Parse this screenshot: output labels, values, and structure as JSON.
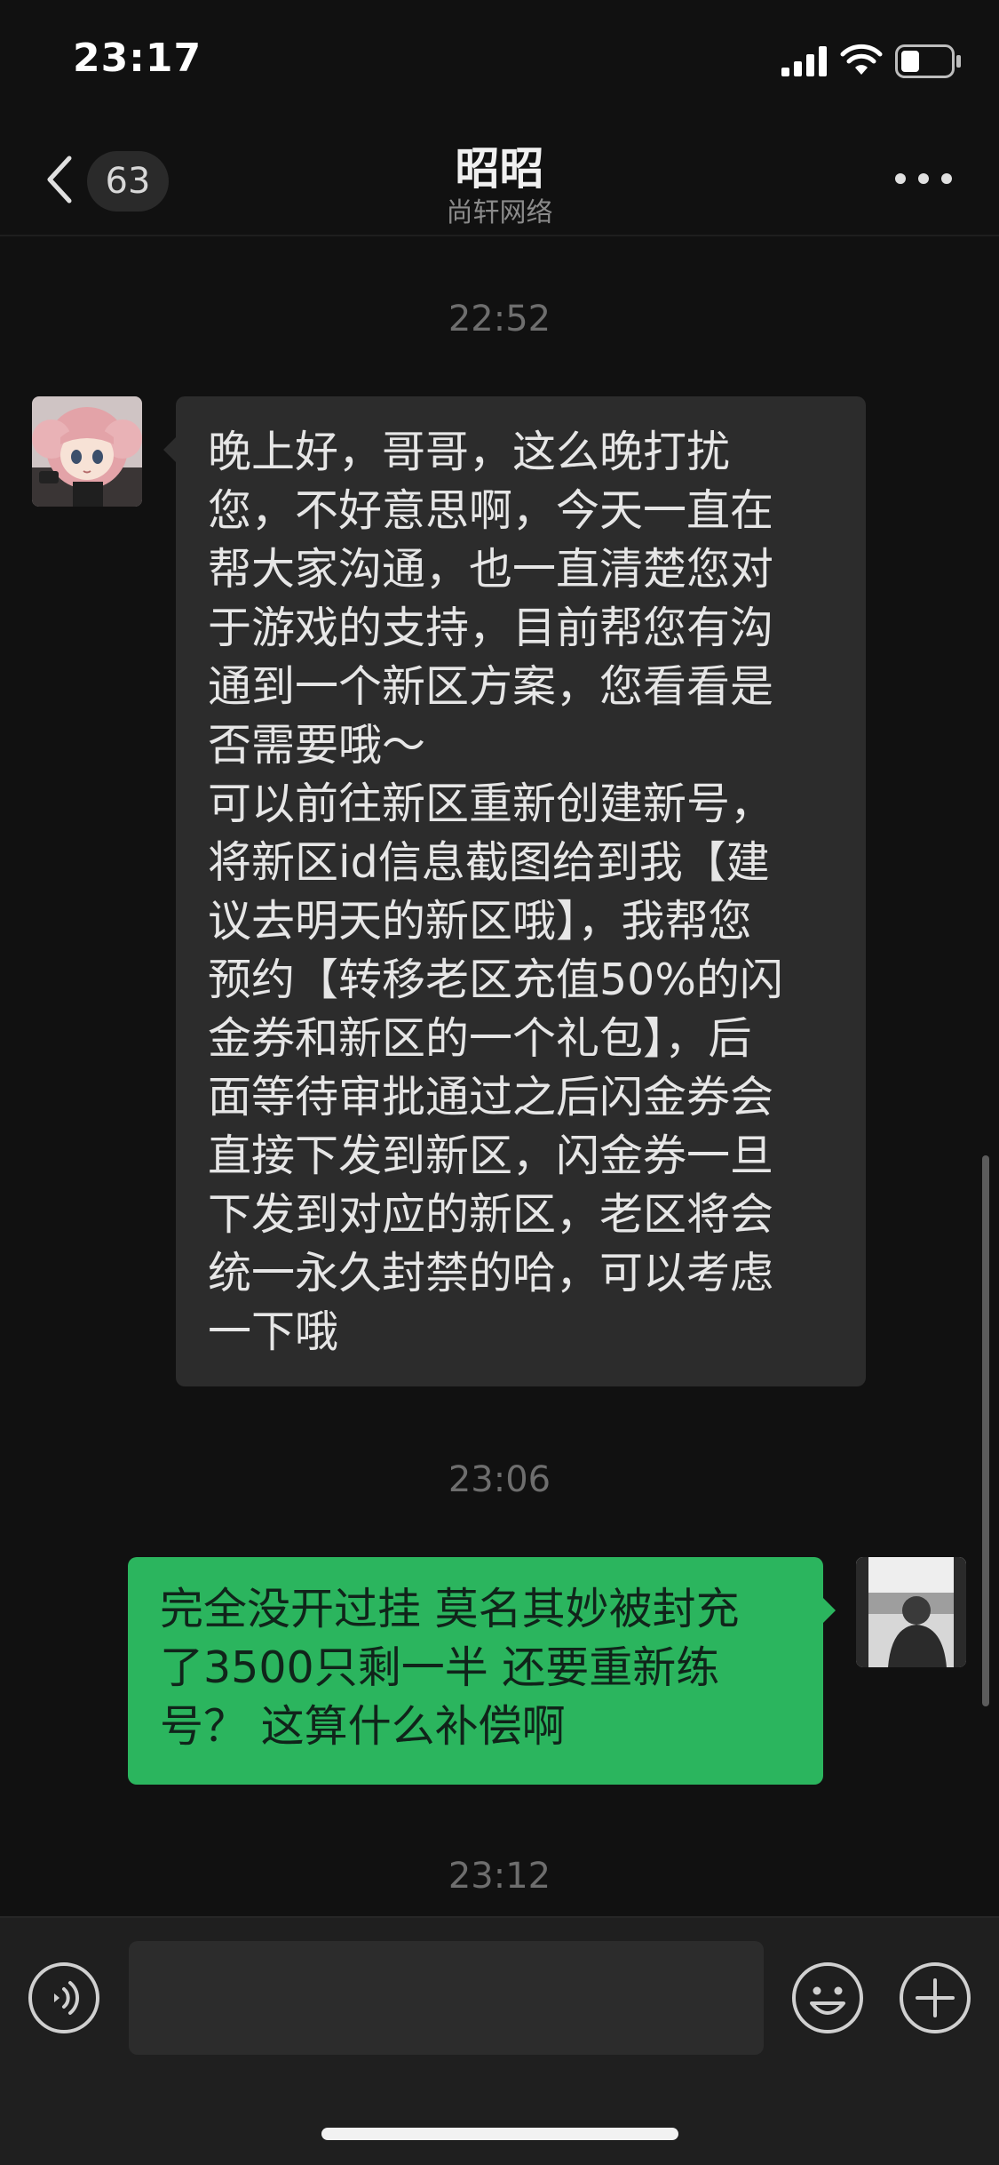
{
  "status_bar": {
    "time": "23:17",
    "icons": [
      "signal-icon",
      "wifi-icon",
      "battery-icon"
    ]
  },
  "header": {
    "unread_count": "63",
    "title": "昭昭",
    "subtitle": "尚轩网络",
    "icons": [
      "chevron-left-icon",
      "more-icon"
    ]
  },
  "chat": {
    "messages": [
      {
        "type": "timestamp",
        "text": "22:52"
      },
      {
        "type": "incoming",
        "avatar_icon": "anime-girl-avatar",
        "text": "晚上好，哥哥，这么晚打扰\n您，不好意思啊，今天一直在\n帮大家沟通，也一直清楚您对\n于游戏的支持，目前帮您有沟\n通到一个新区方案，您看看是\n否需要哦～\n可以前往新区重新创建新号，\n将新区id信息截图给到我【建\n议去明天的新区哦】，我帮您\n预约【转移老区充值50%的闪\n金券和新区的一个礼包】，后\n面等待审批通过之后闪金券会\n直接下发到新区，闪金券一旦\n下发到对应的新区，老区将会\n统一永久封禁的哈，可以考虑\n一下哦"
      },
      {
        "type": "timestamp",
        "text": "23:06"
      },
      {
        "type": "outgoing",
        "avatar_icon": "person-photo-avatar",
        "text": "完全没开过挂 莫名其妙被封充\n了3500只剩一半 还要重新练\n号？ 这算什么补偿啊"
      },
      {
        "type": "timestamp",
        "text": "23:12"
      }
    ]
  },
  "input_bar": {
    "placeholder": "",
    "icons": [
      "voice-icon",
      "emoji-icon",
      "plus-icon"
    ]
  },
  "colors": {
    "background": "#111111",
    "incoming_bubble": "#2c2c2c",
    "outgoing_bubble": "#2bb55e",
    "timestamp_text": "#6e6e6e",
    "input_bar": "#1f1f1f"
  }
}
